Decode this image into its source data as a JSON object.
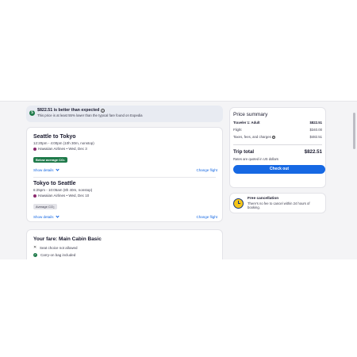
{
  "banner": {
    "title": "$822.51 is better than expected",
    "subtitle": "This price is at least 55% lower than the typical fare found on Expedia"
  },
  "legs": [
    {
      "title": "Seattle to Tokyo",
      "time": "12:20pm - 4:00pm (10h 30m, nonstop)",
      "airline": "Hawaiian Airlines • Wed, Dec 3",
      "badge": "Below average CO₂",
      "show_details": "Show details",
      "change": "Change flight"
    },
    {
      "title": "Tokyo to Seattle",
      "time": "6:25pm - 10:05am (8h 40m, nonstop)",
      "airline": "Hawaiian Airlines • Wed, Dec 10",
      "badge": "Average CO₂",
      "show_details": "Show details",
      "change": "Change flight"
    }
  ],
  "fare": {
    "title": "Your fare: Main Cabin Basic",
    "items": [
      {
        "icon": "x-icon",
        "text": "Seat choice not allowed"
      },
      {
        "icon": "check-icon",
        "text": "Carry-on bag included"
      }
    ]
  },
  "summary": {
    "title": "Price summary",
    "traveler_label": "Traveler 1: Adult",
    "traveler_value": "$822.51",
    "flight_label": "Flight",
    "flight_value": "$340.00",
    "taxes_label": "Taxes, fees, and charges",
    "taxes_value": "$482.51",
    "total_label": "Trip total",
    "total_value": "$822.51",
    "note": "Rates are quoted in US dollars",
    "checkout": "Check out"
  },
  "cancellation": {
    "title": "Free cancellation",
    "text": "There's no fee to cancel within 24 hours of booking."
  },
  "colors": {
    "accent": "#1668e3",
    "green": "#1f7a4a",
    "background": "#f4f4f6"
  }
}
